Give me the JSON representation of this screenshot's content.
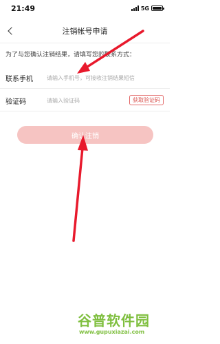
{
  "status_bar": {
    "time": "21:49",
    "network": "5G"
  },
  "nav": {
    "title": "注销帐号申请"
  },
  "notice": "为了与您确认注销结果，请填写您的联系方式：",
  "form": {
    "phone": {
      "label": "联系手机",
      "placeholder": "请输入手机号，可接收注销结果短信"
    },
    "code": {
      "label": "验证码",
      "placeholder": "请输入验证码",
      "button": "获取验证码"
    }
  },
  "confirm_button": "确认注销",
  "watermark": {
    "line1": "谷普软件园",
    "line2": "www.gupuxiazai.com"
  },
  "colors": {
    "accent": "#d9534f",
    "button_disabled": "#f6c4c2",
    "arrow": "#e8192c",
    "watermark": "#7fbf3f"
  },
  "icons": [
    "back-arrow-icon",
    "signal-icon",
    "battery-icon"
  ]
}
